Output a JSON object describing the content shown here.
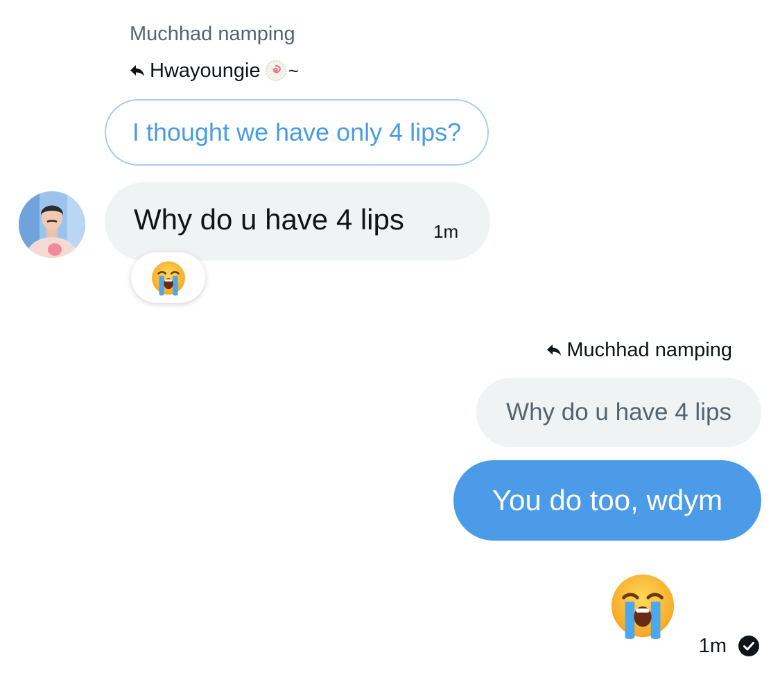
{
  "incoming": {
    "sender_name": "Muchhad namping",
    "reply_to_name": "Hwayoungie",
    "reply_to_suffix": "~",
    "quoted_text": "I thought we have only 4 lips?",
    "message_text": "Why do u have 4 lips",
    "timestamp": "1m",
    "reaction_emoji": "loudly-crying-face",
    "avatar": "user-avatar-photo"
  },
  "outgoing": {
    "reply_to_name": "Muchhad namping",
    "quoted_text": "Why do u have 4 lips",
    "message_text": "You do too, wdym",
    "emoji_message": "loudly-crying-face",
    "timestamp": "1m",
    "status_icon": "check-circle-icon"
  },
  "colors": {
    "accent_blue": "#4c9be8",
    "bubble_gray": "#eff3f4",
    "secondary_text": "#536471",
    "quoted_border": "#a6cdee",
    "quoted_text_blue": "#4a9be6"
  }
}
